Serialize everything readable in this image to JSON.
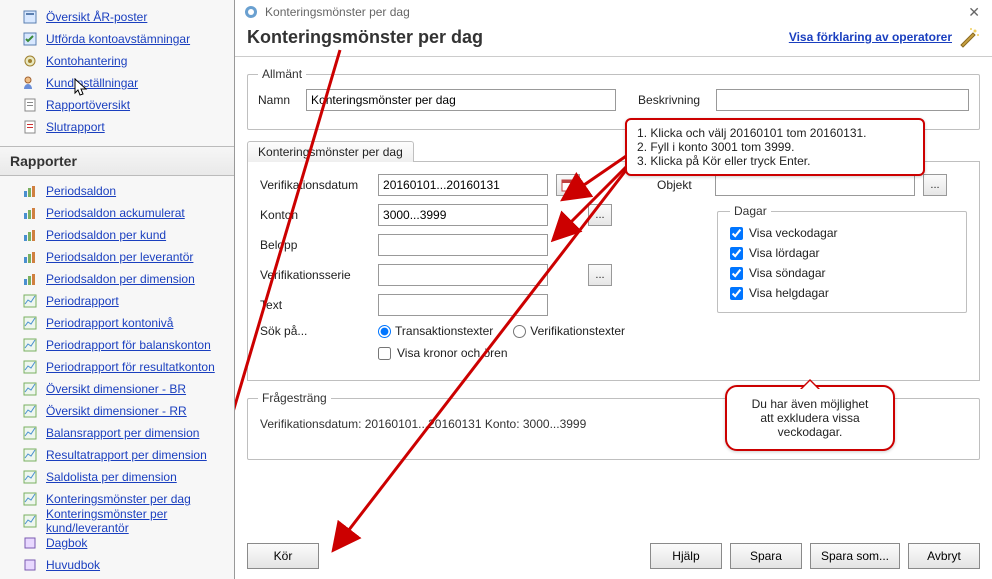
{
  "sidebar_top": [
    {
      "label": "Översikt ÅR-poster"
    },
    {
      "label": "Utförda kontoavstämningar"
    },
    {
      "label": "Kontohantering"
    },
    {
      "label": "Kundinställningar"
    },
    {
      "label": "Rapportöversikt"
    },
    {
      "label": "Slutrapport"
    }
  ],
  "sidebar_section": "Rapporter",
  "reports": [
    {
      "label": "Periodsaldon"
    },
    {
      "label": "Periodsaldon ackumulerat"
    },
    {
      "label": "Periodsaldon per kund"
    },
    {
      "label": "Periodsaldon per leverantör"
    },
    {
      "label": "Periodsaldon per dimension"
    },
    {
      "label": "Periodrapport"
    },
    {
      "label": "Periodrapport kontonivå"
    },
    {
      "label": "Periodrapport för balanskonton"
    },
    {
      "label": "Periodrapport för resultatkonton"
    },
    {
      "label": "Översikt dimensioner - BR"
    },
    {
      "label": "Översikt dimensioner - RR"
    },
    {
      "label": "Balansrapport per dimension"
    },
    {
      "label": "Resultatrapport per dimension"
    },
    {
      "label": "Saldolista per dimension"
    },
    {
      "label": "Konteringsmönster per dag"
    },
    {
      "label": "Konteringsmönster per kund/leverantör"
    },
    {
      "label": "Dagbok"
    },
    {
      "label": "Huvudbok"
    }
  ],
  "window_title": "Konteringsmönster per dag",
  "header_title": "Konteringsmönster per dag",
  "operator_link": "Visa förklaring av operatorer",
  "general_legend": "Allmänt",
  "general_name_label": "Namn",
  "general_name_value": "Konteringsmönster per dag",
  "general_desc_label": "Beskrivning",
  "general_desc_value": "",
  "tab_label": "Konteringsmönster per dag",
  "fields": {
    "verifdate_label": "Verifikationsdatum",
    "verifdate_value": "20160101...20160131",
    "objekt_label": "Objekt",
    "objekt_value": "",
    "konton_label": "Konton",
    "konton_value": "3000...3999",
    "belopp_label": "Belopp",
    "belopp_value": "",
    "verifserie_label": "Verifikationsserie",
    "verifserie_value": "",
    "text_label": "Text",
    "text_value": "",
    "sok_label": "Sök på...",
    "radio_trans": "Transaktionstexter",
    "radio_verif": "Verifikationstexter",
    "kronor_label": "Visa kronor och ören"
  },
  "dagar": {
    "legend": "Dagar",
    "veckodagar": "Visa veckodagar",
    "lordagar": "Visa lördagar",
    "sondagar": "Visa söndagar",
    "helgdagar": "Visa helgdagar"
  },
  "frage_legend": "Frågesträng",
  "frage_text": "Verifikationsdatum: 20160101...20160131    Konto: 3000...3999",
  "buttons": {
    "kor": "Kör",
    "hjalp": "Hjälp",
    "spara": "Spara",
    "sparasom": "Spara som...",
    "avbryt": "Avbryt"
  },
  "callout_steps": {
    "l1": "1. Klicka och välj 20160101 tom 20160131.",
    "l2": "2. Fyll i konto 3001 tom 3999.",
    "l3": "3. Klicka på Kör eller tryck Enter."
  },
  "callout_bubble": {
    "l1": "Du har även möjlighet",
    "l2": "att exkludera vissa",
    "l3": "veckodagar."
  }
}
